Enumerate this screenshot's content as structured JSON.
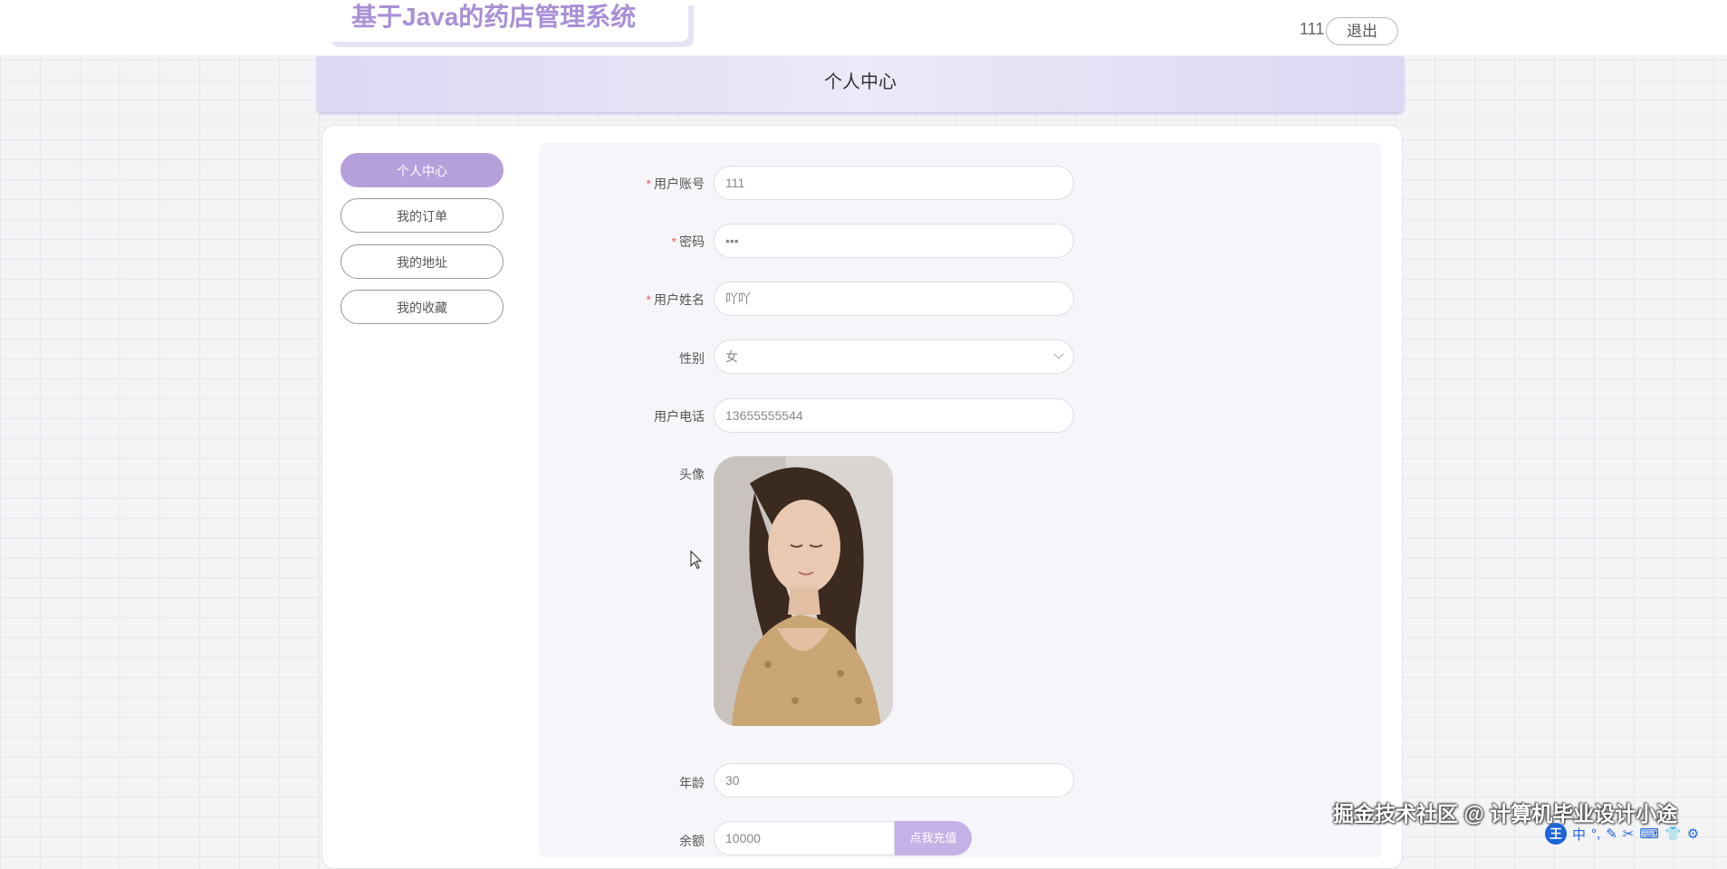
{
  "header": {
    "site_title": "基于Java的药店管理系统",
    "username": "111",
    "logout_label": "退出"
  },
  "page_title": "个人中心",
  "sidebar": {
    "items": [
      {
        "label": "个人中心",
        "active": true
      },
      {
        "label": "我的订单",
        "active": false
      },
      {
        "label": "我的地址",
        "active": false
      },
      {
        "label": "我的收藏",
        "active": false
      }
    ]
  },
  "form": {
    "account": {
      "label": "用户账号",
      "value": "111",
      "required": true
    },
    "password": {
      "label": "密码",
      "value": "•••",
      "required": true
    },
    "name": {
      "label": "用户姓名",
      "value": "吖吖",
      "required": true
    },
    "gender": {
      "label": "性别",
      "value": "女"
    },
    "phone": {
      "label": "用户电话",
      "value": "13655555544"
    },
    "avatar": {
      "label": "头像"
    },
    "age": {
      "label": "年龄",
      "value": "30"
    },
    "balance": {
      "label": "余额",
      "value": "10000",
      "recharge_label": "点我充值"
    }
  },
  "watermark": "掘金技术社区 @ 计算机毕业设计小途",
  "ime": {
    "logo": "王",
    "mode": "中"
  },
  "colors": {
    "accent": "#b6a0dc",
    "logo_text": "#a98fd6",
    "required": "#e96060"
  }
}
